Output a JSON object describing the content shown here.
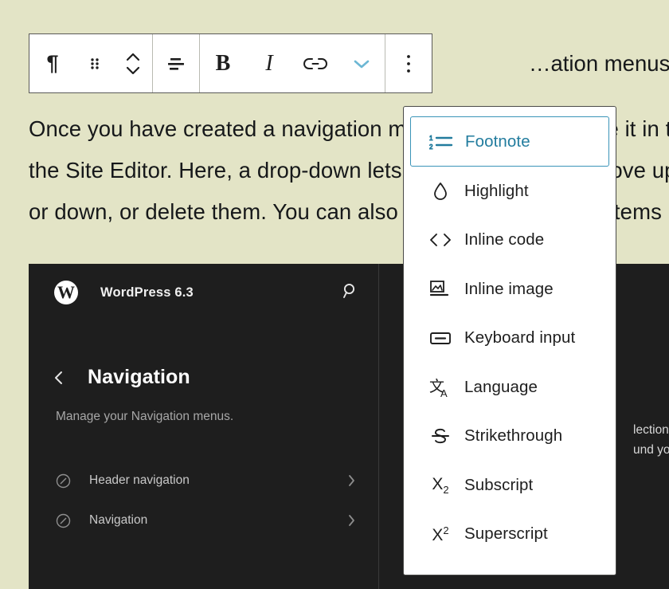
{
  "page": {
    "background_color": "#e3e4c6",
    "text_color": "#16181a"
  },
  "article": {
    "line_above": "…ation menus.",
    "lines": [
      "Once you have created a navigation menu, you can manage it in the",
      "the Site Editor. Here, a drop-down lets you rename them, move up",
      "or down, or delete them. You can also add new menus and items"
    ],
    "visible_fragments": {
      "line1_left": "Once you have created a navigatio",
      "line1_right": "in the",
      "line2_left": "the Site Editor. Here, a drop-down",
      "line2_right": "mov",
      "line3_left": "or down, or delete them. You can a",
      "line3_right": "tems"
    }
  },
  "toolbar": {
    "accent_color": "#6cb7d4",
    "buttons": [
      {
        "name": "paragraph-block-type-button",
        "icon": "paragraph-icon",
        "label": "¶"
      },
      {
        "name": "drag-handle-button",
        "icon": "drag-handle-icon",
        "label": "Drag"
      },
      {
        "name": "move-up-down-button",
        "icon": "chevron-up-down-icon",
        "label": "Move up or down"
      },
      {
        "name": "align-text-button",
        "icon": "align-text-icon",
        "label": "Align text"
      },
      {
        "name": "bold-button",
        "icon": "bold-icon",
        "label": "B"
      },
      {
        "name": "italic-button",
        "icon": "italic-icon",
        "label": "I"
      },
      {
        "name": "link-button",
        "icon": "link-icon",
        "label": "Link"
      },
      {
        "name": "more-formatting-button",
        "icon": "chevron-down-icon",
        "label": "More"
      },
      {
        "name": "options-button",
        "icon": "three-dots-vertical-icon",
        "label": "Options"
      }
    ]
  },
  "menu": {
    "selected_index": 0,
    "selected_color": "#227c9e",
    "border_color": "#3a94b8",
    "items": [
      {
        "label": "Footnote",
        "icon": "numbered-list-icon"
      },
      {
        "label": "Highlight",
        "icon": "droplet-icon"
      },
      {
        "label": "Inline code",
        "icon": "angle-brackets-icon"
      },
      {
        "label": "Inline image",
        "icon": "inline-image-icon"
      },
      {
        "label": "Keyboard input",
        "icon": "keyboard-input-icon"
      },
      {
        "label": "Language",
        "icon": "translate-icon"
      },
      {
        "label": "Strikethrough",
        "icon": "strikethrough-icon"
      },
      {
        "label": "Subscript",
        "icon": "subscript-icon"
      },
      {
        "label": "Superscript",
        "icon": "superscript-icon"
      }
    ]
  },
  "wp": {
    "brand": "WordPress 6.3",
    "search_icon": "search-icon",
    "back_icon": "chevron-left-icon",
    "page_title": "Navigation",
    "page_subtitle": "Manage your Navigation menus.",
    "items": [
      {
        "label": "Header navigation",
        "icon": "navigation-circle-icon",
        "chevron": "chevron-right-icon"
      },
      {
        "label": "Navigation",
        "icon": "navigation-circle-icon",
        "chevron": "chevron-right-icon"
      }
    ],
    "right_panel": {
      "logo": "wordpress-logo-icon",
      "text_line_1": "lection o",
      "text_line_2": "und your"
    }
  }
}
